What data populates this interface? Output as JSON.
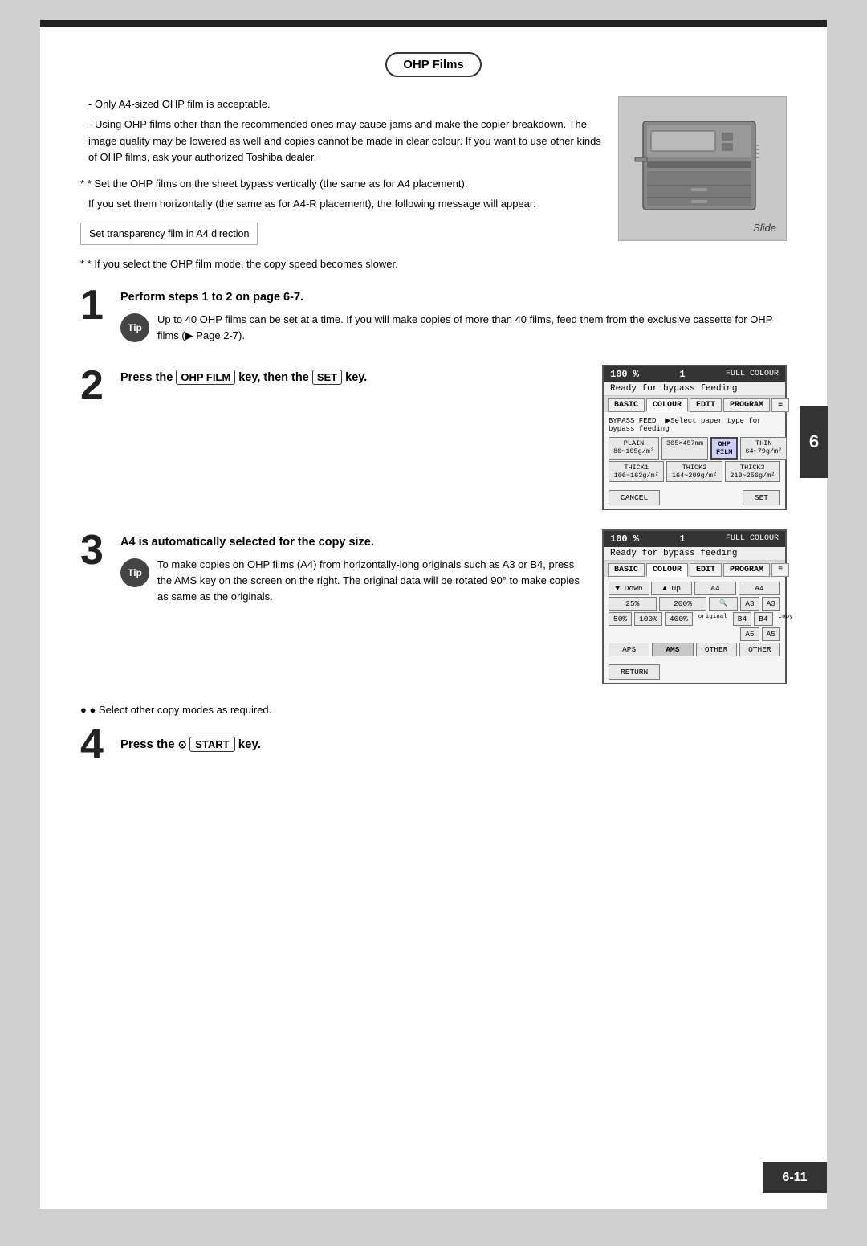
{
  "page": {
    "background_color": "#d0d0d0",
    "page_number": "6-11",
    "side_tab": "6"
  },
  "section": {
    "title": "OHP Films",
    "bullets": [
      "Only A4-sized OHP film is acceptable.",
      "Using OHP films other than the recommended ones may cause jams and make the copier breakdown.  The image quality may be lowered as well and copies cannot be made in clear colour.  If you want to use other kinds of OHP films, ask your authorized Toshiba dealer."
    ],
    "note1": "* Set the OHP films on the sheet bypass vertically (the same as for A4 placement).",
    "note2": "If you set them horizontally (the same as for A4-R placement), the following  message  will  appear:",
    "notice_box": "Set transparency film in A4 direction",
    "note3": "* If you select the OHP film mode, the copy speed becomes slower.",
    "slide_label": "Slide"
  },
  "steps": [
    {
      "number": "1",
      "title": "Perform steps 1 to 2 on page 6-7.",
      "tip_badge": "Tip",
      "tip_text": "Up to 40 OHP films can be set at a time.  If you will make copies of more than 40 films, feed them from the exclusive cassette for OHP films (▶  Page 2-7)."
    },
    {
      "number": "2",
      "title_parts": [
        "Press the ",
        "OHP FILM",
        " key, then the ",
        "SET",
        " key."
      ],
      "panel1": {
        "header_left": "100  %",
        "header_mid": "1",
        "header_right": "FULL COLOUR",
        "status": "Ready for bypass feeding",
        "tabs": [
          "BASIC",
          "COLOUR",
          "EDIT",
          "PROGRAM"
        ],
        "active_tab": "COLOUR",
        "row1_label": "BYPASS FEED",
        "row1_text": "▶Select paper type for bypass feeding",
        "buttons": [
          [
            "PLAIN\n80~105g/m²",
            "305×457mm",
            "OHP FILM",
            "THIN\n64~79g/m²"
          ],
          [
            "THICK1\n106~163g/m²",
            "THICK2\n164~209g/m²",
            "THICK3\n210~256g/m²"
          ]
        ],
        "footer": [
          "CANCEL",
          "SET"
        ]
      }
    },
    {
      "number": "3",
      "title": "A4 is automatically selected for the copy size.",
      "tip_badge": "Tip",
      "tip_text": "To make copies on OHP films (A4) from horizontally-long originals such as A3 or B4, press the AMS key on the screen on the right. The original data will be rotated 90° to make copies as same as the originals.",
      "panel2": {
        "header_left": "100  %",
        "header_mid": "1",
        "header_right": "FULL COLOUR",
        "status": "Ready for bypass feeding",
        "tabs": [
          "BASIC",
          "COLOUR",
          "EDIT",
          "PROGRAM"
        ],
        "active_tab": "COLOUR",
        "row1": [
          "▼ Down",
          "▲ Up"
        ],
        "row2_cols": [
          "A4",
          "A4"
        ],
        "row3": [
          "25%",
          "200%",
          "",
          "A3",
          "A3"
        ],
        "row4": [
          "50%",
          "100%",
          "400%",
          "original",
          "B4",
          "B4",
          "copy"
        ],
        "row5": [
          "A5",
          "A5"
        ],
        "row6": [
          "APS",
          "AMS",
          "OTHER",
          "OTHER"
        ],
        "footer": [
          "RETURN"
        ]
      }
    }
  ],
  "step4": {
    "number": "4",
    "title_prefix": "Press the ",
    "start_key": "START",
    "title_suffix": " key."
  },
  "bullet_select": "● Select other copy modes as required."
}
